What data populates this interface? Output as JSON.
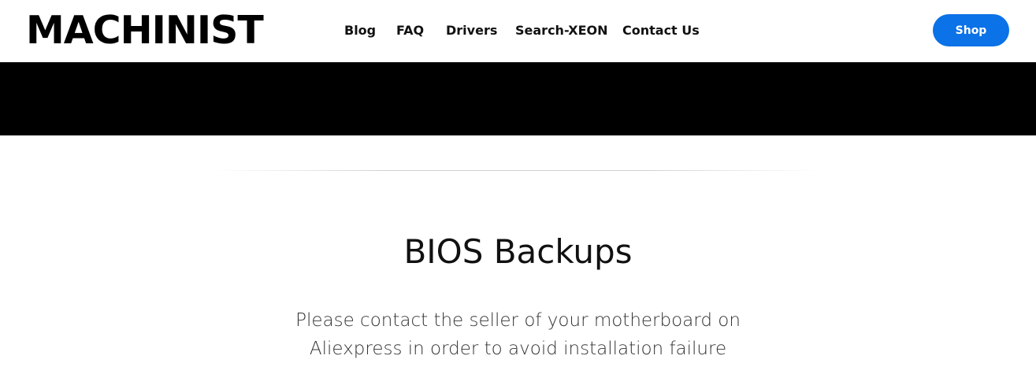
{
  "header": {
    "logo": "MACHINIST",
    "nav": [
      {
        "label": "Blog"
      },
      {
        "label": "FAQ"
      },
      {
        "label": "Drivers"
      },
      {
        "label": "Search-XEON"
      },
      {
        "label": "Contact Us"
      }
    ],
    "shop_label": "Shop"
  },
  "colors": {
    "accent": "#0b72e7",
    "hero_band": "#000000",
    "text": "#111111"
  },
  "main": {
    "title": "BIOS Backups",
    "message_lines": [
      "Please contact the seller of your motherboard on",
      "Aliexpress in order to avoid installation failure"
    ]
  }
}
